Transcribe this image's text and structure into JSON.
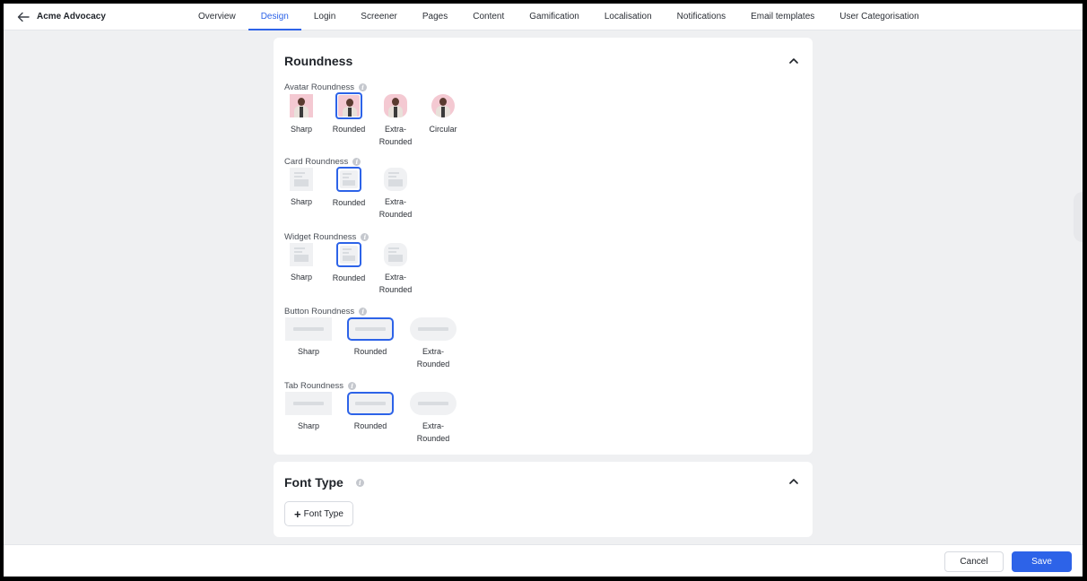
{
  "header": {
    "back_icon": "arrow-left-icon",
    "app_title": "Acme Advocacy",
    "tabs": [
      {
        "label": "Overview",
        "active": false
      },
      {
        "label": "Design",
        "active": true
      },
      {
        "label": "Login",
        "active": false
      },
      {
        "label": "Screener",
        "active": false
      },
      {
        "label": "Pages",
        "active": false
      },
      {
        "label": "Content",
        "active": false
      },
      {
        "label": "Gamification",
        "active": false
      },
      {
        "label": "Localisation",
        "active": false
      },
      {
        "label": "Notifications",
        "active": false
      },
      {
        "label": "Email templates",
        "active": false
      },
      {
        "label": "User Categorisation",
        "active": false
      }
    ]
  },
  "roundness": {
    "title": "Roundness",
    "collapse_icon": "chevron-up-icon",
    "info_icon": "info-icon",
    "avatar": {
      "label": "Avatar Roundness",
      "selected": "Rounded",
      "options": [
        "Sharp",
        "Rounded",
        "Extra-\nRounded",
        "Circular"
      ]
    },
    "card": {
      "label": "Card Roundness",
      "selected": "Rounded",
      "options": [
        "Sharp",
        "Rounded",
        "Extra-\nRounded"
      ]
    },
    "widget": {
      "label": "Widget Roundness",
      "selected": "Rounded",
      "options": [
        "Sharp",
        "Rounded",
        "Extra-\nRounded"
      ]
    },
    "button": {
      "label": "Button Roundness",
      "selected": "Rounded",
      "options": [
        "Sharp",
        "Rounded",
        "Extra-\nRounded"
      ]
    },
    "tab": {
      "label": "Tab Roundness",
      "selected": "Rounded",
      "options": [
        "Sharp",
        "Rounded",
        "Extra-\nRounded"
      ]
    }
  },
  "font_type": {
    "title": "Font Type",
    "add_button": "Font Type",
    "add_icon": "plus-icon"
  },
  "footer": {
    "cancel": "Cancel",
    "save": "Save"
  },
  "colors": {
    "accent": "#2d63e8",
    "page_bg": "#eff0f2",
    "avatar_bg": "#f4c9d2"
  }
}
